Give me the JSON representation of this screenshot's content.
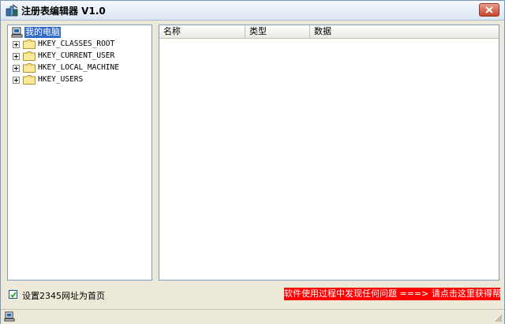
{
  "window": {
    "title": "注册表编辑器 V1.0"
  },
  "tree": {
    "root_label": "我的电脑",
    "keys": [
      {
        "label": "HKEY_CLASSES_ROOT"
      },
      {
        "label": "HKEY_CURRENT_USER"
      },
      {
        "label": "HKEY_LOCAL_MACHINE"
      },
      {
        "label": "HKEY_USERS"
      }
    ]
  },
  "list": {
    "columns": [
      "名称",
      "类型",
      "数据"
    ]
  },
  "options": {
    "homepage_checkbox_label": "设置2345网址为首页",
    "homepage_checked": true
  },
  "help": {
    "link_text": "软件使用过程中发现任何问题 ===> 请点击这里获得帮助"
  },
  "colors": {
    "selection": "#316ac5",
    "help_background": "#ff0000"
  }
}
